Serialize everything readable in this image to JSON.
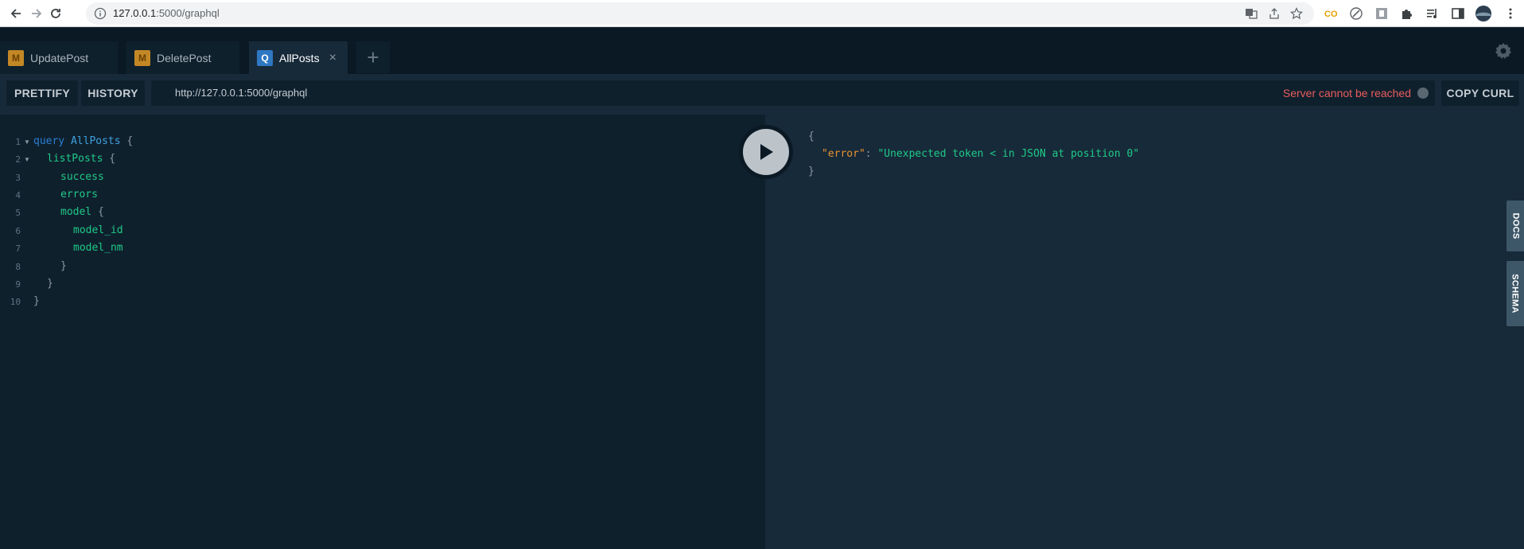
{
  "browser": {
    "url_host": "127.0.0.1",
    "url_path": ":5000/graphql",
    "icons": [
      "back-arrow-icon",
      "forward-arrow-icon",
      "reload-icon",
      "info-icon",
      "translate-icon",
      "share-icon",
      "star-icon",
      "extension-icons",
      "profile-avatar",
      "menu-icon"
    ]
  },
  "tabs": [
    {
      "badge": "M",
      "label": "UpdatePost",
      "active": false
    },
    {
      "badge": "M",
      "label": "DeletePost",
      "active": false
    },
    {
      "badge": "Q",
      "label": "AllPosts",
      "active": true,
      "close": "×"
    }
  ],
  "add_tab": "+",
  "toolbar": {
    "prettify": "PRETTIFY",
    "history": "HISTORY",
    "endpoint": "http://127.0.0.1:5000/graphql",
    "status": "Server cannot be reached",
    "copy_curl": "COPY CURL"
  },
  "editor": {
    "line_numbers": [
      "1",
      "2",
      "3",
      "4",
      "5",
      "6",
      "7",
      "8",
      "9",
      "10"
    ],
    "lines": {
      "l1_kw": "query",
      "l1_name": "AllPosts",
      "l1_brace": "{",
      "l2_field": "listPosts",
      "l2_brace": "{",
      "l3_field": "success",
      "l4_field": "errors",
      "l5_field": "model",
      "l5_brace": "{",
      "l6_field": "model_id",
      "l7_field": "model_nm",
      "l8_brace": "}",
      "l9_brace": "}",
      "l10_brace": "}"
    }
  },
  "result": {
    "open_brace": "{",
    "key": "\"error\"",
    "colon": ": ",
    "value": "\"Unexpected token < in JSON at position 0\"",
    "close_brace": "}"
  },
  "side_tabs": {
    "docs": "DOCS",
    "schema": "SCHEMA"
  },
  "colors": {
    "bg": "#172a3a",
    "editor_bg": "#0f202d",
    "error": "#e95c5c",
    "field": "#1fc986",
    "keyword": "#2a7ed3",
    "json_key": "#e8922f"
  }
}
